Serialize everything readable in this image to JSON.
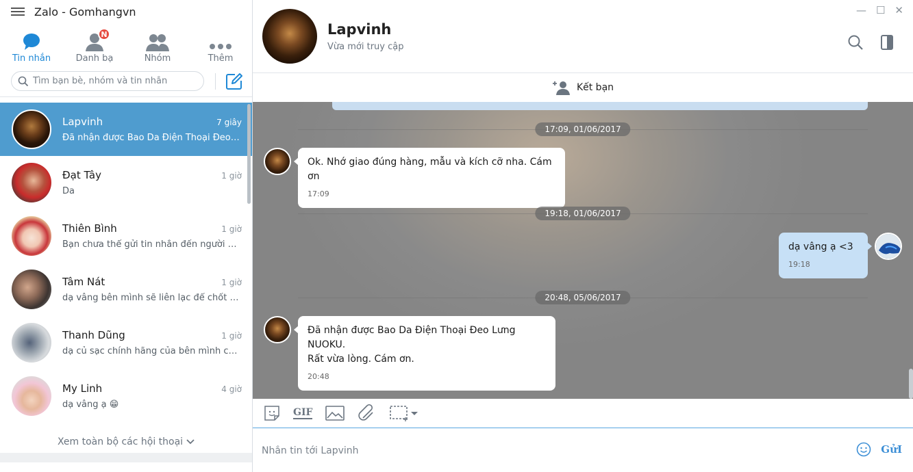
{
  "app": {
    "title": "Zalo - Gomhangvn"
  },
  "nav": [
    {
      "label": "Tin nhắn",
      "icon": "chat-bubble-icon",
      "active": true
    },
    {
      "label": "Danh bạ",
      "icon": "contacts-icon",
      "badge": "N"
    },
    {
      "label": "Nhóm",
      "icon": "group-icon"
    },
    {
      "label": "Thêm",
      "icon": "more-dots-icon"
    }
  ],
  "search": {
    "placeholder": "Tìm bạn bè, nhóm và tin nhắn"
  },
  "conversations": [
    {
      "name": "Lapvinh",
      "time": "7 giây",
      "preview": "Đã nhận được Bao Da Điện Thoại Đeo L...",
      "active": true
    },
    {
      "name": "Đạt Tây",
      "time": "1 giờ",
      "preview": "Da"
    },
    {
      "name": "Thiên Bình",
      "time": "1 giờ",
      "preview": "Bạn chưa thể gửi tin nhắn đến người nà..."
    },
    {
      "name": "Tâm Nát",
      "time": "1 giờ",
      "preview": "dạ vâng bên mình sẽ liên lạc để chốt đ..."
    },
    {
      "name": "Thanh Dũng",
      "time": "1 giờ",
      "preview": "dạ củ sạc chính hãng của bên mình có ..."
    },
    {
      "name": "My Linh",
      "time": "4 giờ",
      "preview": "dạ vâng ạ 😁"
    }
  ],
  "view_all": "Xem toàn bộ các hội thoại",
  "contact": {
    "name": "Lapvinh",
    "status": "Vừa mới truy cập"
  },
  "add_friend": "Kết bạn",
  "dates": [
    "17:09, 01/06/2017",
    "19:18, 01/06/2017",
    "20:48, 05/06/2017"
  ],
  "messages": [
    {
      "direction": "in",
      "lines": [
        "Ok. Nhớ giao đúng hàng, mẫu và kích cỡ nha. Cám ơn"
      ],
      "time": "17:09"
    },
    {
      "direction": "out",
      "lines": [
        "dạ vâng ạ <3"
      ],
      "time": "19:18"
    },
    {
      "direction": "in",
      "lines": [
        "Đã nhận được Bao Da Điện Thoại Đeo Lưng NUOKU.",
        "Rất vừa lòng. Cám ơn."
      ],
      "time": "20:48"
    }
  ],
  "toolbar": {
    "gif": "GIF"
  },
  "composer": {
    "placeholder": "Nhắn tin tới Lapvinh",
    "send": "GửI"
  },
  "colors": {
    "accent": "#1e88d6",
    "active_row": "#4f9ccf",
    "badge": "#e64a3f",
    "out_bubble": "#c7e0f6"
  }
}
